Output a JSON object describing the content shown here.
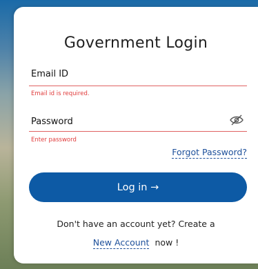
{
  "login": {
    "title": "Government Login",
    "email": {
      "label": "Email ID",
      "value": "",
      "error": "Email id is required."
    },
    "password": {
      "label": "Password",
      "value": "",
      "error": "Enter password",
      "toggle_icon": "eye-off-icon"
    },
    "forgot_password": "Forgot Password?",
    "submit_label": "Log in →",
    "signup_prompt": "Don't have an account yet? Create a",
    "new_account": "New Account",
    "signup_suffix": "now !"
  },
  "colors": {
    "primary": "#0d5aa5",
    "link": "#1c4f9a",
    "error": "#e03b3b"
  }
}
